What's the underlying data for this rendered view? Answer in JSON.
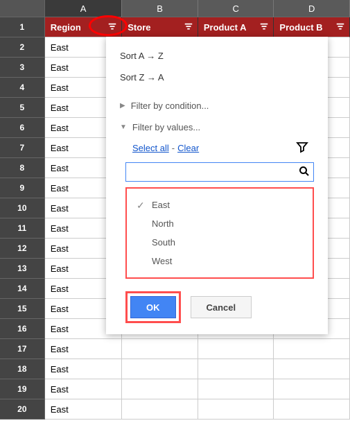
{
  "columns": {
    "a": "A",
    "b": "B",
    "c": "C",
    "d": "D"
  },
  "headers": {
    "region": "Region",
    "store": "Store",
    "productA": "Product A",
    "productB": "Product B"
  },
  "rows": [
    {
      "n": "1"
    },
    {
      "n": "2"
    },
    {
      "n": "3"
    },
    {
      "n": "4"
    },
    {
      "n": "5"
    },
    {
      "n": "6"
    },
    {
      "n": "7"
    },
    {
      "n": "8"
    },
    {
      "n": "9"
    },
    {
      "n": "10"
    },
    {
      "n": "11"
    },
    {
      "n": "12"
    },
    {
      "n": "13"
    },
    {
      "n": "14"
    },
    {
      "n": "15"
    },
    {
      "n": "16"
    },
    {
      "n": "17"
    },
    {
      "n": "18"
    },
    {
      "n": "19"
    },
    {
      "n": "20"
    }
  ],
  "cellValue": "East",
  "dropdown": {
    "sortAZ": "Sort A → Z",
    "sortZA": "Sort Z → A",
    "filterCondition": "Filter by condition...",
    "filterValues": "Filter by values...",
    "selectAll": "Select all",
    "clear": "Clear",
    "values": [
      {
        "label": "East",
        "checked": true
      },
      {
        "label": "North",
        "checked": false
      },
      {
        "label": "South",
        "checked": false
      },
      {
        "label": "West",
        "checked": false
      }
    ],
    "ok": "OK",
    "cancel": "Cancel"
  }
}
